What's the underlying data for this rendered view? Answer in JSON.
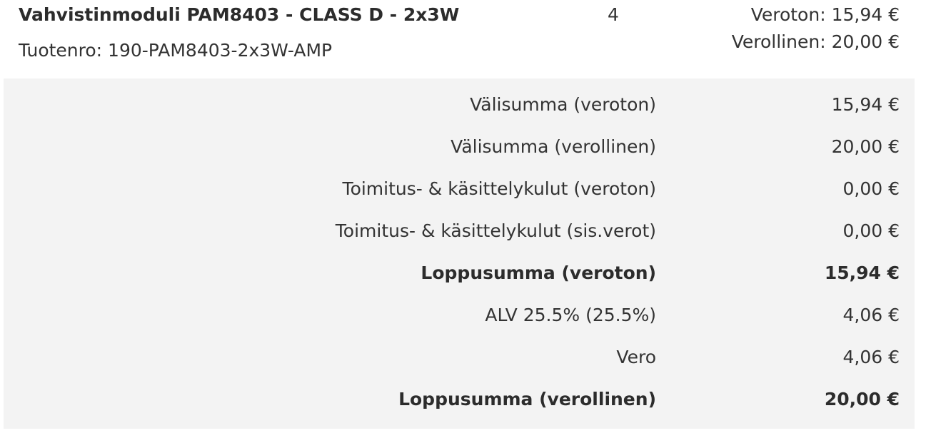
{
  "product": {
    "name": "Vahvistinmoduli PAM8403 - CLASS D - 2x3W",
    "sku": "Tuotenro: 190-PAM8403-2x3W-AMP",
    "quantity": "4",
    "price_excl": "Veroton: 15,94 €",
    "price_incl": "Verollinen: 20,00 €"
  },
  "totals": [
    {
      "label": "Välisumma (veroton)",
      "value": "15,94 €",
      "bold": false
    },
    {
      "label": "Välisumma (verollinen)",
      "value": "20,00 €",
      "bold": false
    },
    {
      "label": "Toimitus- & käsittelykulut (veroton)",
      "value": "0,00 €",
      "bold": false
    },
    {
      "label": "Toimitus- & käsittelykulut (sis.verot)",
      "value": "0,00 €",
      "bold": false
    },
    {
      "label": "Loppusumma (veroton)",
      "value": "15,94 €",
      "bold": true
    },
    {
      "label": "ALV 25.5% (25.5%)",
      "value": "4,06 €",
      "bold": false
    },
    {
      "label": "Vero",
      "value": "4,06 €",
      "bold": false
    },
    {
      "label": "Loppusumma (verollinen)",
      "value": "20,00 €",
      "bold": true
    }
  ],
  "colors": {
    "text": "#333333",
    "totals_background": "#f3f3f3"
  }
}
